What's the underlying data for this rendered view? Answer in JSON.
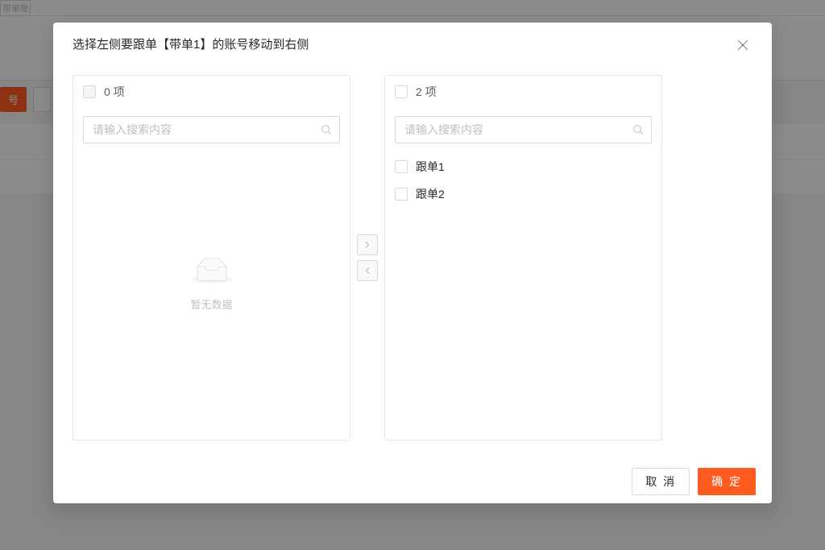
{
  "bg": {
    "input_fragment": "带单账号名",
    "btn_primary_fragment": "号",
    "btn_ghost_fragment": ""
  },
  "modal": {
    "title": "选择左侧要跟单【带单1】的账号移动到右侧",
    "left": {
      "count_label": "0 项",
      "search_placeholder": "请输入搜索内容",
      "empty_text": "暂无数据"
    },
    "right": {
      "count_label": "2 项",
      "search_placeholder": "请输入搜索内容",
      "items": [
        {
          "label": "跟单1"
        },
        {
          "label": "跟单2"
        }
      ]
    },
    "footer": {
      "cancel": "取 消",
      "ok": "确 定"
    }
  }
}
